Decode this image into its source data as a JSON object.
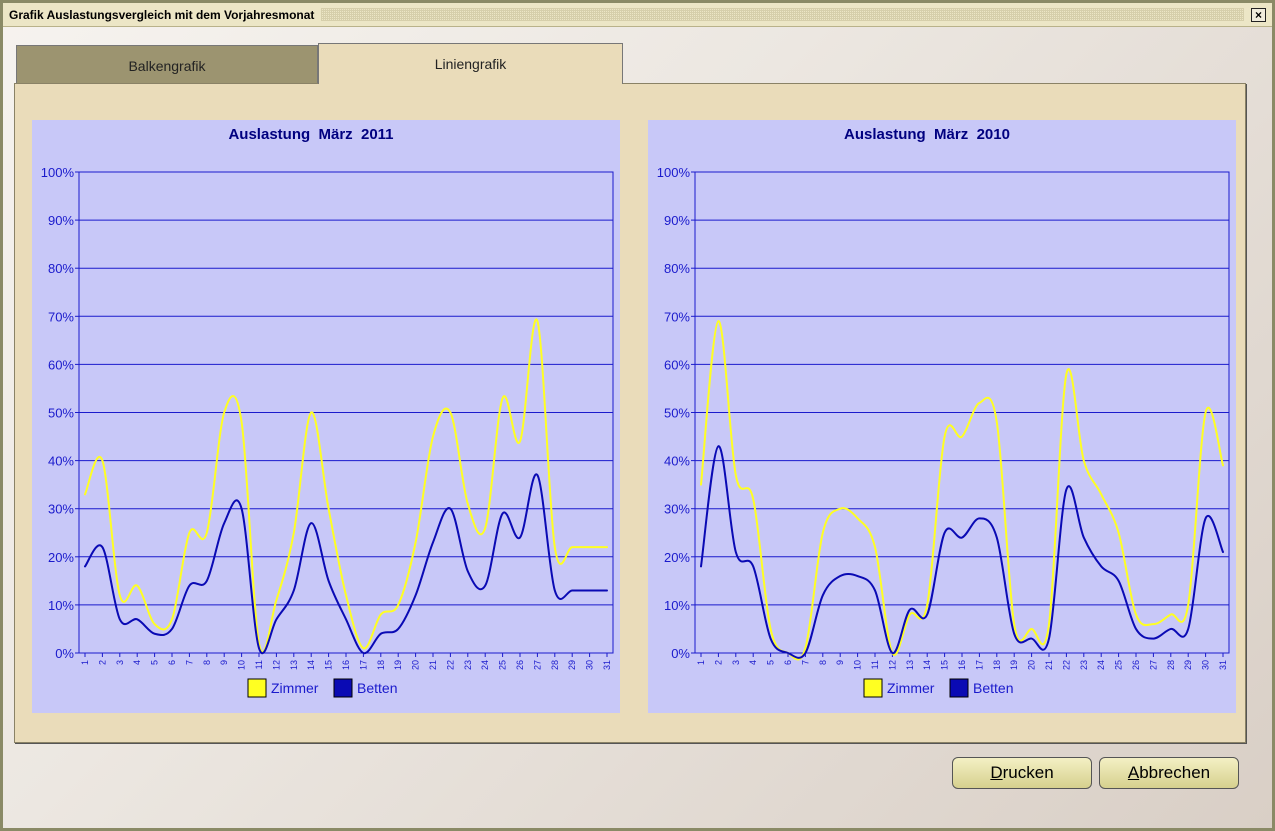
{
  "window": {
    "title": "Grafik Auslastungsvergleich mit dem Vorjahresmonat",
    "close_glyph": "×"
  },
  "tabs": [
    {
      "label": "Balkengrafik",
      "active": false
    },
    {
      "label": "Liniengrafik",
      "active": true
    }
  ],
  "buttons": {
    "print": "Drucken",
    "cancel": "Abbrechen"
  },
  "colors": {
    "chart_bg": "#c8c8f8",
    "axis": "#1a1acc",
    "zimmer": "#ffff22",
    "betten": "#0a0ab4",
    "text": "#1a1acc",
    "title": "#000080"
  },
  "chart_data": [
    {
      "type": "line",
      "title": "Auslastung  März  2011",
      "x": [
        1,
        2,
        3,
        4,
        5,
        6,
        7,
        8,
        9,
        10,
        11,
        12,
        13,
        14,
        15,
        16,
        17,
        18,
        19,
        20,
        21,
        22,
        23,
        24,
        25,
        26,
        27,
        28,
        29,
        30,
        31
      ],
      "ylim": [
        0,
        100
      ],
      "yticks": [
        "0%",
        "10%",
        "20%",
        "30%",
        "40%",
        "50%",
        "60%",
        "70%",
        "80%",
        "90%",
        "100%"
      ],
      "grid": true,
      "legend": "bottom-center",
      "series": [
        {
          "name": "Zimmer",
          "color": "#ffff22",
          "values": [
            33,
            40,
            12,
            14,
            6,
            7,
            25,
            25,
            50,
            48,
            2,
            11,
            25,
            50,
            30,
            12,
            1,
            8,
            10,
            23,
            45,
            50,
            31,
            26,
            53,
            44,
            69,
            22,
            22,
            22,
            22
          ]
        },
        {
          "name": "Betten",
          "color": "#0a0ab4",
          "values": [
            18,
            22,
            7,
            7,
            4,
            5,
            14,
            15,
            27,
            30,
            1,
            7,
            13,
            27,
            15,
            7,
            0,
            4,
            5,
            12,
            23,
            30,
            17,
            14,
            29,
            24,
            37,
            13,
            13,
            13,
            13
          ]
        }
      ]
    },
    {
      "type": "line",
      "title": "Auslastung  März  2010",
      "x": [
        1,
        2,
        3,
        4,
        5,
        6,
        7,
        8,
        9,
        10,
        11,
        12,
        13,
        14,
        15,
        16,
        17,
        18,
        19,
        20,
        21,
        22,
        23,
        24,
        25,
        26,
        27,
        28,
        29,
        30,
        31
      ],
      "ylim": [
        0,
        100
      ],
      "yticks": [
        "0%",
        "10%",
        "20%",
        "30%",
        "40%",
        "50%",
        "60%",
        "70%",
        "80%",
        "90%",
        "100%"
      ],
      "grid": true,
      "legend": "bottom-center",
      "series": [
        {
          "name": "Zimmer",
          "color": "#ffff22",
          "values": [
            35,
            69,
            37,
            32,
            5,
            0,
            1,
            25,
            30,
            28,
            22,
            0,
            8,
            10,
            45,
            45,
            52,
            48,
            6,
            5,
            6,
            58,
            40,
            33,
            25,
            8,
            6,
            8,
            10,
            50,
            39
          ]
        },
        {
          "name": "Betten",
          "color": "#0a0ab4",
          "values": [
            18,
            43,
            21,
            18,
            3,
            0,
            0,
            12,
            16,
            16,
            13,
            0,
            9,
            8,
            25,
            24,
            28,
            24,
            4,
            3,
            3,
            34,
            24,
            18,
            15,
            5,
            3,
            5,
            5,
            28,
            21
          ]
        }
      ]
    }
  ]
}
